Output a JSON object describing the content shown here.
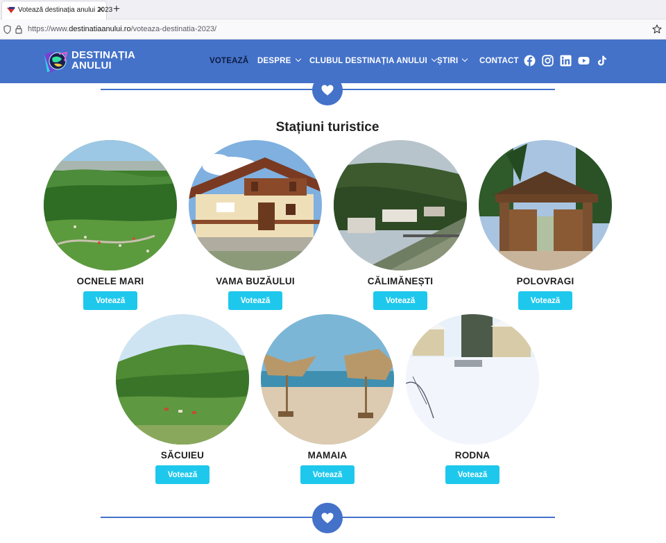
{
  "browser": {
    "tab_title": "Votează destinația anului 2023",
    "tab_close": "✕",
    "new_tab": "+",
    "url_prefix": "https://www.",
    "url_host": "destinatiaanului.ro",
    "url_path": "/voteaza-destinatia-2023/"
  },
  "header": {
    "logo_line1": "DESTINAȚIA",
    "logo_line2": "ANULUI",
    "nav": [
      {
        "label": "VOTEAZĂ",
        "active": true,
        "dropdown": false
      },
      {
        "label": "DESPRE",
        "active": false,
        "dropdown": true
      },
      {
        "label": "CLUBUL DESTINAȚIA ANULUI",
        "active": false,
        "dropdown": true
      },
      {
        "label": "ȘTIRI",
        "active": false,
        "dropdown": true
      },
      {
        "label": "CONTACT",
        "active": false,
        "dropdown": false
      }
    ],
    "social_icons": [
      "facebook-icon",
      "instagram-icon",
      "linkedin-icon",
      "youtube-icon",
      "tiktok-icon"
    ]
  },
  "section": {
    "title": "Stațiuni turistice",
    "cards": [
      {
        "name": "OCNELE MARI",
        "button": "Votează"
      },
      {
        "name": "VAMA BUZĂULUI",
        "button": "Votează"
      },
      {
        "name": "CĂLIMĂNEȘTI",
        "button": "Votează"
      },
      {
        "name": "POLOVRAGI",
        "button": "Votează"
      },
      {
        "name": "SĂCUIEU",
        "button": "Votează"
      },
      {
        "name": "MAMAIA",
        "button": "Votează"
      },
      {
        "name": "RODNA",
        "button": "Votează"
      }
    ]
  },
  "colors": {
    "brand_blue": "#4472c9",
    "vote_button": "#1ec8ec",
    "active_nav": "#0d1b3e"
  }
}
